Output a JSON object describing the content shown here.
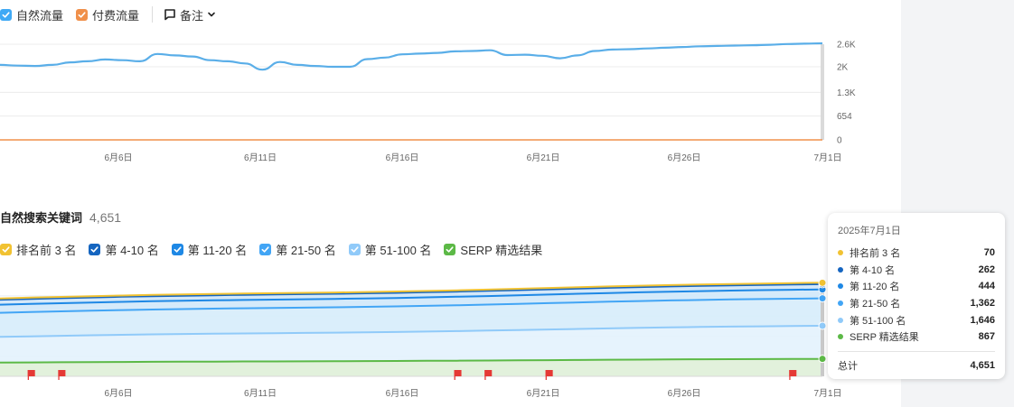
{
  "traffic_legend": {
    "organic": {
      "label": "自然流量",
      "color": "#3fa9f5"
    },
    "paid": {
      "label": "付费流量",
      "color": "#f0904a"
    },
    "notes": {
      "label": "备注"
    }
  },
  "keywords_section": {
    "title": "自然搜索关键词",
    "count": "4,651"
  },
  "keywords_legend": [
    {
      "label": "排名前 3 名",
      "color": "#f1c232"
    },
    {
      "label": "第 4-10 名",
      "color": "#1565c0"
    },
    {
      "label": "第 11-20 名",
      "color": "#1e88e5"
    },
    {
      "label": "第 21-50 名",
      "color": "#42a5f5"
    },
    {
      "label": "第 51-100 名",
      "color": "#90caf9"
    },
    {
      "label": "SERP 精选结果",
      "color": "#5cb946"
    }
  ],
  "tooltip": {
    "date": "2025年7月1日",
    "rows": [
      {
        "label": "排名前 3 名",
        "value": "70",
        "color": "#f1c232"
      },
      {
        "label": "第 4-10 名",
        "value": "262",
        "color": "#1565c0"
      },
      {
        "label": "第 11-20 名",
        "value": "444",
        "color": "#1e88e5"
      },
      {
        "label": "第 21-50 名",
        "value": "1,362",
        "color": "#42a5f5"
      },
      {
        "label": "第 51-100 名",
        "value": "1,646",
        "color": "#90caf9"
      },
      {
        "label": "SERP 精选结果",
        "value": "867",
        "color": "#5cb946"
      }
    ],
    "total_label": "总计",
    "total_value": "4,651"
  },
  "chart_data": [
    {
      "type": "line",
      "x_tick_labels": [
        "6月6日",
        "6月11日",
        "6月16日",
        "6月21日",
        "6月26日",
        "7月1日"
      ],
      "y_tick_labels": [
        "2.6K",
        "2K",
        "1.3K",
        "654",
        "0"
      ],
      "ylim": [
        0,
        2616
      ],
      "grid": true,
      "series": [
        {
          "name": "自然流量",
          "color": "#5aaee8",
          "values": [
            2050,
            2030,
            2020,
            2050,
            2120,
            2150,
            2200,
            2180,
            2150,
            2350,
            2310,
            2280,
            2180,
            2150,
            2090,
            1920,
            2130,
            2050,
            2020,
            2000,
            2000,
            2210,
            2250,
            2340,
            2360,
            2380,
            2420,
            2430,
            2450,
            2320,
            2330,
            2300,
            2230,
            2310,
            2430,
            2470,
            2480,
            2500,
            2520,
            2540,
            2560,
            2570,
            2580,
            2590,
            2600,
            2620,
            2630,
            2640
          ]
        },
        {
          "name": "付费流量",
          "color": "#f0904a",
          "values": [
            0,
            0,
            0,
            0,
            0,
            0,
            0,
            0,
            0,
            0,
            0,
            0,
            0,
            0,
            0,
            0,
            0,
            0,
            0,
            0,
            0,
            0,
            0,
            0,
            0,
            0,
            0,
            0,
            0,
            0,
            0,
            0,
            0,
            0,
            0,
            0,
            0,
            0,
            0,
            0,
            0,
            0,
            0,
            0,
            0,
            0,
            0,
            0
          ]
        }
      ]
    },
    {
      "type": "area",
      "stacked": true,
      "x_tick_labels": [
        "6月6日",
        "6月11日",
        "6月16日",
        "6月21日",
        "6月26日",
        "7月1日"
      ],
      "ylim": [
        0,
        4800
      ],
      "series_order_bottom_to_top": [
        "SERP 精选结果",
        "第 51-100 名",
        "第 21-50 名",
        "第 11-20 名",
        "第 4-10 名",
        "排名前 3 名"
      ],
      "series": [
        {
          "name": "SERP 精选结果",
          "color": "#5cb946",
          "start": 680,
          "end": 867
        },
        {
          "name": "第 51-100 名",
          "color": "#90caf9",
          "start": 1280,
          "end": 1646
        },
        {
          "name": "第 21-50 名",
          "color": "#42a5f5",
          "start": 1200,
          "end": 1362
        },
        {
          "name": "第 11-20 名",
          "color": "#1e88e5",
          "start": 400,
          "end": 444
        },
        {
          "name": "第 4-10 名",
          "color": "#1565c0",
          "start": 250,
          "end": 262
        },
        {
          "name": "排名前 3 名",
          "color": "#f1c232",
          "start": 60,
          "end": 70
        }
      ],
      "note_flags_at_x": [
        1.0,
        2.0,
        15.0,
        16.0,
        18.0,
        26.0
      ]
    }
  ]
}
